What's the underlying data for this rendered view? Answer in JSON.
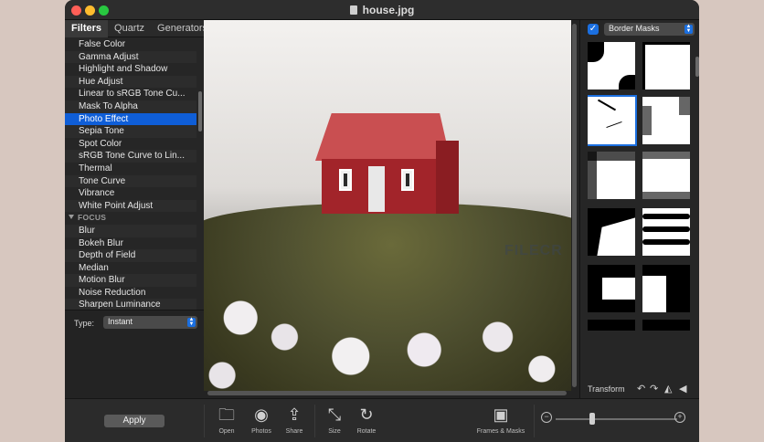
{
  "window": {
    "title": "house.jpg",
    "doc_icon": "document-icon"
  },
  "tabs": [
    "Filters",
    "Quartz",
    "Generators"
  ],
  "filters": [
    {
      "label": "False Color"
    },
    {
      "label": "Gamma Adjust"
    },
    {
      "label": "Highlight and Shadow"
    },
    {
      "label": "Hue Adjust"
    },
    {
      "label": "Linear to sRGB Tone Cu..."
    },
    {
      "label": "Mask To Alpha"
    },
    {
      "label": "Photo Effect",
      "selected": true
    },
    {
      "label": "Sepia Tone"
    },
    {
      "label": "Spot Color"
    },
    {
      "label": "sRGB Tone Curve to Lin..."
    },
    {
      "label": "Thermal"
    },
    {
      "label": "Tone Curve"
    },
    {
      "label": "Vibrance"
    },
    {
      "label": "White Point Adjust"
    },
    {
      "label": "FOCUS",
      "group": true
    },
    {
      "label": "Blur"
    },
    {
      "label": "Bokeh Blur"
    },
    {
      "label": "Depth of Field"
    },
    {
      "label": "Median"
    },
    {
      "label": "Motion Blur"
    },
    {
      "label": "Noise Reduction"
    },
    {
      "label": "Sharpen Luminance"
    }
  ],
  "type": {
    "label": "Type:",
    "value": "Instant"
  },
  "watermark": "FILECR",
  "right": {
    "checkbox_checked": true,
    "masks_select": "Border Masks",
    "transform_label": "Transform",
    "transform_icons": [
      "rotate-left-icon",
      "rotate-right-icon",
      "flip-horizontal-icon",
      "flip-vertical-icon"
    ]
  },
  "toolbar": {
    "apply": "Apply",
    "tools": [
      {
        "label": "Open",
        "icon": "folder-icon"
      },
      {
        "label": "Photos",
        "icon": "camera-icon"
      },
      {
        "label": "Share",
        "icon": "share-icon"
      },
      {
        "label": "Size",
        "icon": "resize-icon"
      },
      {
        "label": "Rotate",
        "icon": "rotate-icon"
      },
      {
        "label": "Frames & Masks",
        "icon": "frame-icon"
      }
    ],
    "zoom_out_icon": "zoom-out-icon",
    "zoom_in_icon": "zoom-in-icon"
  },
  "colors": {
    "accent": "#1b6fe0",
    "selected_row": "#0f5ed7",
    "panel": "#262626"
  }
}
